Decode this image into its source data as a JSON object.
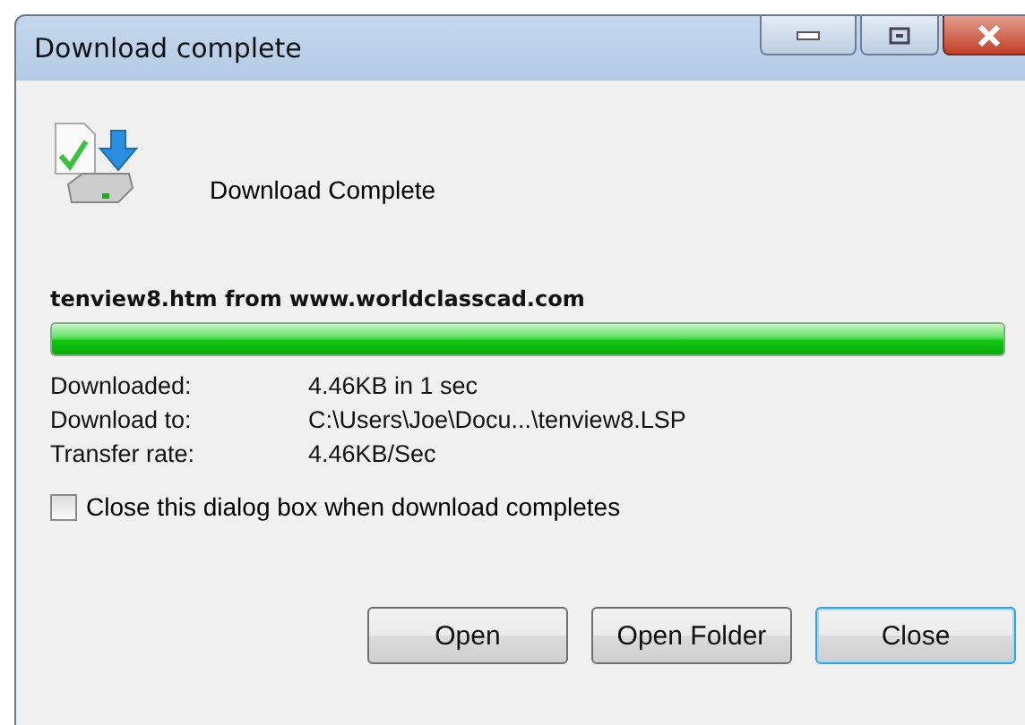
{
  "window": {
    "title": "Download complete"
  },
  "heading": "Download Complete",
  "source": "tenview8.htm from www.worldclasscad.com",
  "progress": {
    "level": 1
  },
  "details": [
    {
      "label": "Downloaded:",
      "value": "4.46KB in 1 sec"
    },
    {
      "label": "Download to:",
      "value": "C:\\Users\\Joe\\Docu...\\tenview8.LSP"
    },
    {
      "label": "Transfer rate:",
      "value": "4.46KB/Sec"
    }
  ],
  "close_when_done": {
    "label": "Close this dialog box when download completes",
    "checked": false
  },
  "buttons": [
    {
      "label": "Open",
      "default": false
    },
    {
      "label": "Open Folder",
      "default": false
    },
    {
      "label": "Close",
      "default": true
    }
  ]
}
